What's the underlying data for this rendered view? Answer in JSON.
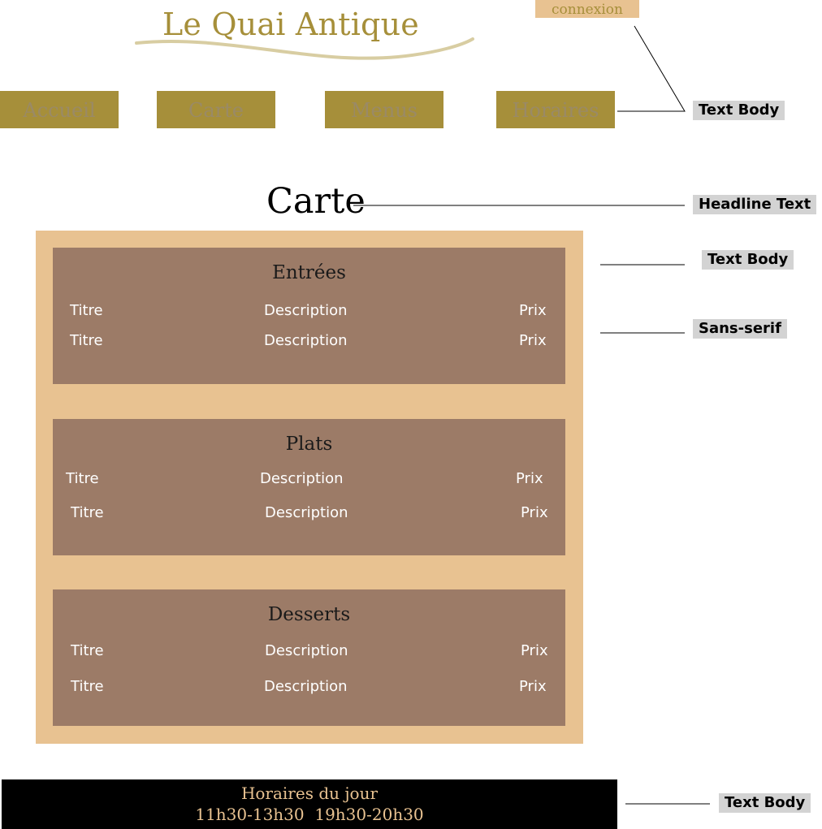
{
  "header": {
    "brand": "Le Quai Antique",
    "login_label": "connexion"
  },
  "nav": {
    "items": [
      {
        "label": "Accueil"
      },
      {
        "label": "Carte"
      },
      {
        "label": "Menus"
      },
      {
        "label": "Horaires"
      }
    ]
  },
  "page_title": "Carte",
  "menu": {
    "sections": [
      {
        "title": "Entrées",
        "rows": [
          {
            "title": "Titre",
            "description": "Description",
            "price": "Prix"
          },
          {
            "title": "Titre",
            "description": "Description",
            "price": "Prix"
          }
        ]
      },
      {
        "title": "Plats",
        "rows": [
          {
            "title": "Titre",
            "description": "Description",
            "price": "Prix"
          },
          {
            "title": "Titre",
            "description": "Description",
            "price": "Prix"
          }
        ]
      },
      {
        "title": "Desserts",
        "rows": [
          {
            "title": "Titre",
            "description": "Description",
            "price": "Prix"
          },
          {
            "title": "Titre",
            "description": "Description",
            "price": "Prix"
          }
        ]
      }
    ]
  },
  "footer": {
    "line1": "Horaires du jour",
    "line2": "11h30-13h30  19h30-20h30"
  },
  "annotations": {
    "nav_font": "Text Body",
    "headline_font": "Headline Text",
    "section_title_font": "Text Body",
    "items_font": "Sans-serif",
    "footer_font": "Text Body"
  },
  "colors": {
    "gold": "#a68f3a",
    "sand": "#e8c291",
    "brown": "#9c7b67",
    "black": "#000000"
  }
}
